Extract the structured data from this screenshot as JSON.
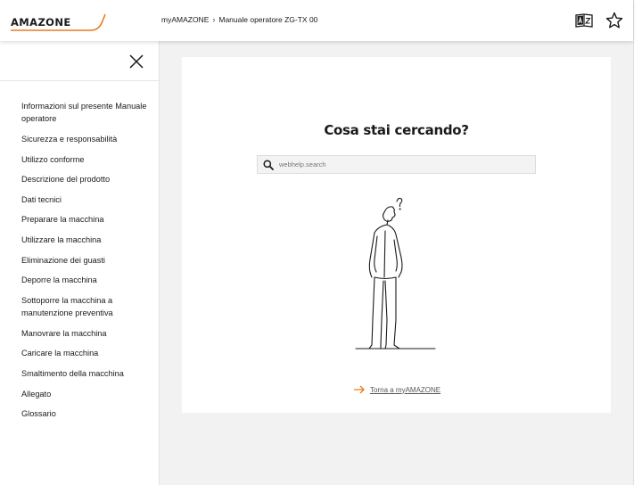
{
  "header": {
    "logo_text": "AMAZONE",
    "breadcrumb": [
      "myAMAZONE",
      "Manuale operatore ZG-TX 00"
    ],
    "breadcrumb_separator": "›",
    "icons": [
      "language-dictionary-icon",
      "star-icon"
    ]
  },
  "sidebar": {
    "close_icon": "close-icon",
    "items": [
      "Informazioni sul presente Manuale operatore",
      "Sicurezza e responsabilità",
      "Utilizzo conforme",
      "Descrizione del prodotto",
      "Dati tecnici",
      "Preparare la macchina",
      "Utilizzare la macchina",
      "Eliminazione dei guasti",
      "Deporre la macchina",
      "Sottoporre la macchina a manutenzione preventiva",
      "Manovrare la macchina",
      "Caricare la macchina",
      "Smaltimento della macchina",
      "Allegato",
      "Glossario"
    ]
  },
  "main": {
    "title": "Cosa stai cercando?",
    "search_placeholder": "webhelp.search",
    "back_link": "Torna a myAMAZONE"
  },
  "colors": {
    "accent_orange": "#ec7a1c",
    "text": "#1a1a1a",
    "background": "#f2f2f2"
  }
}
